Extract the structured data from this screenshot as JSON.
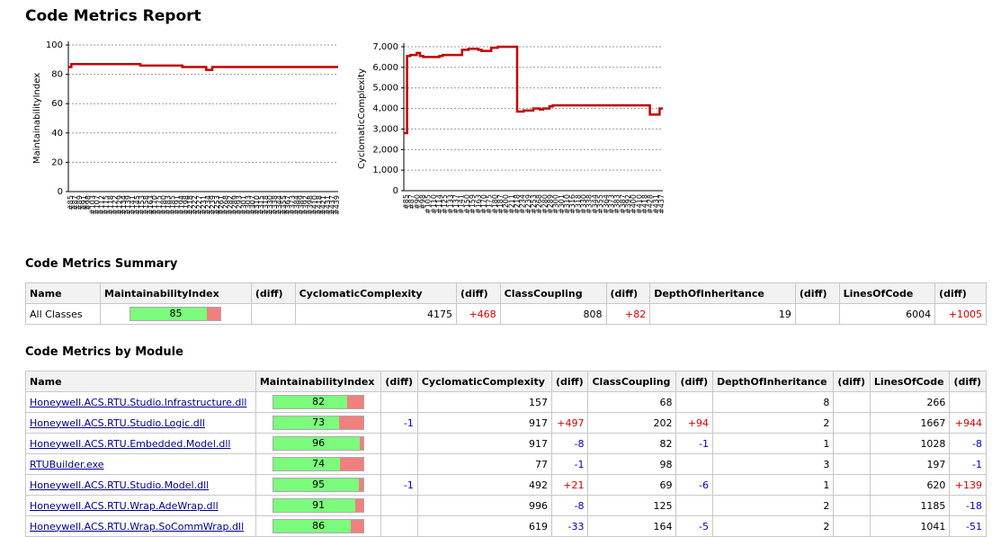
{
  "report_title": "Code Metrics Report",
  "charts": [
    {
      "ylabel": "MaintainabilityIndex",
      "ylim": [
        0,
        100
      ],
      "yticks": [
        "0",
        "20",
        "40",
        "60",
        "80",
        "100"
      ],
      "xticks": [
        "#85",
        "#87",
        "#89",
        "#91",
        "#98",
        "#103",
        "#107",
        "#112",
        "#115",
        "#118",
        "#122",
        "#129",
        "#134",
        "#139",
        "#141",
        "#145",
        "#153",
        "#158",
        "#163",
        "#170",
        "#175",
        "#180",
        "#183",
        "#185",
        "#191",
        "#194",
        "#198",
        "#218",
        "#222",
        "#227",
        "#231",
        "#234",
        "#239",
        "#253",
        "#261",
        "#268",
        "#282",
        "#289",
        "#293",
        "#301",
        "#303",
        "#307",
        "#310",
        "#315",
        "#318",
        "#330",
        "#338",
        "#344",
        "#355",
        "#367",
        "#373",
        "#384",
        "#389",
        "#392",
        "#398",
        "#410",
        "#418",
        "#421",
        "#431",
        "#437",
        "#439"
      ]
    },
    {
      "ylabel": "CyclomaticComplexity",
      "ylim": [
        0,
        7000
      ],
      "yticks": [
        "0",
        "1,000",
        "2,000",
        "3,000",
        "4,000",
        "5,000",
        "6,000",
        "7,000"
      ],
      "xticks": [
        "#85",
        "#87",
        "#90",
        "#98",
        "#105",
        "#110",
        "#114",
        "#125",
        "#133",
        "#137",
        "#141",
        "#150",
        "#159",
        "#163",
        "#170",
        "#175",
        "#180",
        "#187",
        "#200",
        "#211",
        "#218",
        "#234",
        "#239",
        "#253",
        "#268",
        "#280",
        "#289",
        "#300",
        "#301",
        "#310",
        "#316",
        "#318",
        "#330",
        "#338",
        "#344",
        "#355",
        "#364",
        "#373",
        "#383",
        "#387",
        "#392",
        "#400",
        "#410",
        "#418",
        "#428",
        "#431",
        "#437"
      ]
    }
  ],
  "chart_data": [
    {
      "type": "line",
      "ylabel": "MaintainabilityIndex",
      "ylim": [
        0,
        100
      ],
      "series": [
        {
          "values": [
            85,
            87,
            87,
            87,
            87,
            87,
            87,
            87,
            87,
            87,
            87,
            87,
            87,
            87,
            87,
            87,
            87,
            87,
            87,
            87,
            87,
            87,
            87,
            87,
            86,
            86,
            86,
            86,
            86,
            86,
            86,
            86,
            86,
            86,
            86,
            86,
            86,
            86,
            85,
            85,
            85,
            85,
            85,
            85,
            85,
            85,
            83,
            83,
            85,
            85,
            85,
            85,
            85,
            85,
            85,
            85,
            85,
            85,
            85,
            85,
            85,
            85,
            85,
            85,
            85,
            85,
            85,
            85,
            85,
            85,
            85,
            85,
            85,
            85,
            85,
            85,
            85,
            85,
            85,
            85,
            85,
            85,
            85,
            85,
            85,
            85,
            85,
            85,
            85,
            85
          ]
        }
      ]
    },
    {
      "type": "line",
      "ylabel": "CyclomaticComplexity",
      "ylim": [
        0,
        7000
      ],
      "series": [
        {
          "values": [
            2800,
            6550,
            6600,
            6600,
            6700,
            6550,
            6500,
            6500,
            6500,
            6500,
            6500,
            6550,
            6600,
            6600,
            6600,
            6600,
            6600,
            6600,
            6850,
            6850,
            6900,
            6900,
            6900,
            6850,
            6800,
            6800,
            6800,
            6950,
            6950,
            7000,
            7000,
            7000,
            7000,
            7000,
            7000,
            3850,
            3850,
            3900,
            3900,
            3900,
            4000,
            4000,
            3950,
            4000,
            4000,
            4100,
            4150,
            4150,
            4150,
            4150,
            4150,
            4150,
            4150,
            4150,
            4150,
            4150,
            4150,
            4150,
            4150,
            4150,
            4150,
            4150,
            4150,
            4150,
            4150,
            4150,
            4150,
            4150,
            4150,
            4150,
            4150,
            4150,
            4150,
            4150,
            4150,
            4150,
            3700,
            3700,
            3700,
            4000
          ]
        }
      ]
    }
  ],
  "summary": {
    "title": "Code Metrics Summary",
    "headers": [
      "Name",
      "MaintainabilityIndex",
      "(diff)",
      "CyclomaticComplexity",
      "(diff)",
      "ClassCoupling",
      "(diff)",
      "DepthOfInheritance",
      "(diff)",
      "LinesOfCode",
      "(diff)"
    ],
    "row": {
      "name": "All Classes",
      "mi": "85",
      "mi_value": 85,
      "mi_diff": "",
      "cc": "4175",
      "cc_diff": "+468",
      "coup": "808",
      "coup_diff": "+82",
      "depth": "19",
      "depth_diff": "",
      "loc": "6004",
      "loc_diff": "+1005"
    }
  },
  "modules": {
    "title": "Code Metrics by Module",
    "headers": [
      "Name",
      "MaintainabilityIndex",
      "(diff)",
      "CyclomaticComplexity",
      "(diff)",
      "ClassCoupling",
      "(diff)",
      "DepthOfInheritance",
      "(diff)",
      "LinesOfCode",
      "(diff)"
    ],
    "rows": [
      {
        "name": "Honeywell.ACS.RTU.Studio.Infrastructure.dll",
        "mi": "82",
        "mi_value": 82,
        "mi_diff": "",
        "cc": "157",
        "cc_diff": "",
        "coup": "68",
        "coup_diff": "",
        "depth": "8",
        "depth_diff": "",
        "loc": "266",
        "loc_diff": ""
      },
      {
        "name": "Honeywell.ACS.RTU.Studio.Logic.dll",
        "mi": "73",
        "mi_value": 73,
        "mi_diff": "-1",
        "cc": "917",
        "cc_diff": "+497",
        "coup": "202",
        "coup_diff": "+94",
        "depth": "2",
        "depth_diff": "",
        "loc": "1667",
        "loc_diff": "+944"
      },
      {
        "name": "Honeywell.ACS.RTU.Embedded.Model.dll",
        "mi": "96",
        "mi_value": 96,
        "mi_diff": "",
        "cc": "917",
        "cc_diff": "-8",
        "coup": "82",
        "coup_diff": "-1",
        "depth": "1",
        "depth_diff": "",
        "loc": "1028",
        "loc_diff": "-8"
      },
      {
        "name": "RTUBuilder.exe",
        "mi": "74",
        "mi_value": 74,
        "mi_diff": "",
        "cc": "77",
        "cc_diff": "-1",
        "coup": "98",
        "coup_diff": "",
        "depth": "3",
        "depth_diff": "",
        "loc": "197",
        "loc_diff": "-1"
      },
      {
        "name": "Honeywell.ACS.RTU.Studio.Model.dll",
        "mi": "95",
        "mi_value": 95,
        "mi_diff": "-1",
        "cc": "492",
        "cc_diff": "+21",
        "coup": "69",
        "coup_diff": "-6",
        "depth": "1",
        "depth_diff": "",
        "loc": "620",
        "loc_diff": "+139"
      },
      {
        "name": "Honeywell.ACS.RTU.Wrap.AdeWrap.dll",
        "mi": "91",
        "mi_value": 91,
        "mi_diff": "",
        "cc": "996",
        "cc_diff": "-8",
        "coup": "125",
        "coup_diff": "",
        "depth": "2",
        "depth_diff": "",
        "loc": "1185",
        "loc_diff": "-18"
      },
      {
        "name": "Honeywell.ACS.RTU.Wrap.SoCommWrap.dll",
        "mi": "86",
        "mi_value": 86,
        "mi_diff": "",
        "cc": "619",
        "cc_diff": "-33",
        "coup": "164",
        "coup_diff": "-5",
        "depth": "2",
        "depth_diff": "",
        "loc": "1041",
        "loc_diff": "-51"
      }
    ]
  },
  "colors": {
    "line": "#c00000",
    "bar_good": "#7cfc7c",
    "bar_bad": "#f08080",
    "positive_diff": "#d00000",
    "negative_diff": "#0000c0"
  }
}
